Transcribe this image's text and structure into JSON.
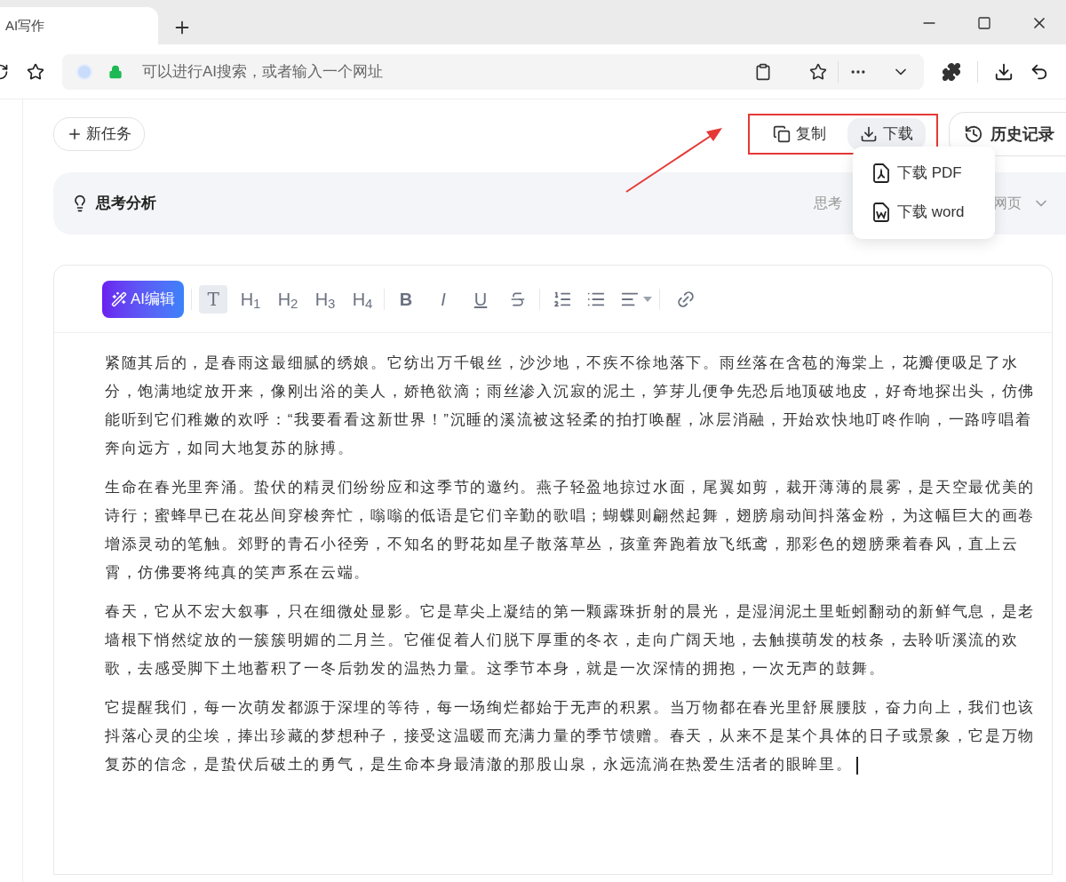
{
  "browser": {
    "tab_title": "AI写作",
    "address_placeholder": "可以进行AI搜索，或者输入一个网址"
  },
  "top_bar": {
    "new_task": "新任务",
    "actions": [
      {
        "label": "复制",
        "kind": "copy",
        "selected": false
      },
      {
        "label": "下载",
        "kind": "download",
        "selected": true
      }
    ],
    "history": "历史记录"
  },
  "download_menu": [
    {
      "label": "下载 PDF",
      "kind": "pdf"
    },
    {
      "label": "下载 word",
      "kind": "word"
    }
  ],
  "thinking": {
    "title": "思考分析",
    "summary_start": "思考",
    "summary_end": "网页",
    "expanded": false
  },
  "editor": {
    "ai_button": "AI编辑",
    "formats": [
      {
        "label": "T",
        "kind": "text",
        "selected": true
      },
      {
        "label": "H$_{1}$",
        "kind": "heading",
        "selected": false
      },
      {
        "label": "H$_{2}$",
        "kind": "heading",
        "selected": false
      },
      {
        "label": "H$_{3}$",
        "kind": "heading",
        "selected": false
      },
      {
        "label": "H$_{4}$",
        "kind": "heading",
        "selected": false
      },
      {
        "label": "B",
        "kind": "bold",
        "selected": false
      },
      {
        "label": "I",
        "kind": "italic",
        "selected": false
      },
      {
        "label": "U",
        "kind": "underline",
        "selected": false
      },
      {
        "kind": "strike",
        "selected": false
      }
    ],
    "paragraphs": [
      "紧随其后的，是春雨这最细腻的绣娘。它纺出万千银丝，沙沙地，不疾不徐地落下。雨丝落在含苞的海棠上，花瓣便吸足了水分，饱满地绽放开来，像刚出浴的美人，娇艳欲滴；雨丝渗入沉寂的泥土，笋芽儿便争先恐后地顶破地皮，好奇地探出头，仿佛能听到它们稚嫩的欢呼：“我要看看这新世界！”沉睡的溪流被这轻柔的拍打唤醒，冰层消融，开始欢快地叮咚作响，一路哼唱着奔向远方，如同大地复苏的脉搏。",
      "生命在春光里奔涌。蛰伏的精灵们纷纷应和这季节的邀约。燕子轻盈地掠过水面，尾翼如剪，裁开薄薄的晨雾，是天空最优美的诗行；蜜蜂早已在花丛间穿梭奔忙，嗡嗡的低语是它们辛勤的歌唱；蝴蝶则翩然起舞，翅膀扇动间抖落金粉，为这幅巨大的画卷增添灵动的笔触。郊野的青石小径旁，不知名的野花如星子散落草丛，孩童奔跑着放飞纸鸢，那彩色的翅膀乘着春风，直上云霄，仿佛要将纯真的笑声系在云端。",
      "春天，它从不宏大叙事，只在细微处显影。它是草尖上凝结的第一颗露珠折射的晨光，是湿润泥土里蚯蚓翻动的新鲜气息，是老墙根下悄然绽放的一簇簇明媚的二月兰。它催促着人们脱下厚重的冬衣，走向广阔天地，去触摸萌发的枝条，去聆听溪流的欢歌，去感受脚下土地蓄积了一冬后勃发的温热力量。这季节本身，就是一次深情的拥抱，一次无声的鼓舞。",
      "它提醒我们，每一次萌发都源于深埋的等待，每一场绚烂都始于无声的积累。当万物都在春光里舒展腰肢，奋力向上，我们也该抖落心灵的尘埃，捧出珍藏的梦想种子，接受这温暖而充满力量的季节馈赠。春天，从来不是某个具体的日子或景象，它是万物复苏的信念，是蛰伏后破土的勇气，是生命本身最清澈的那股山泉，永远流淌在热爱生活者的眼眸里。"
    ]
  }
}
